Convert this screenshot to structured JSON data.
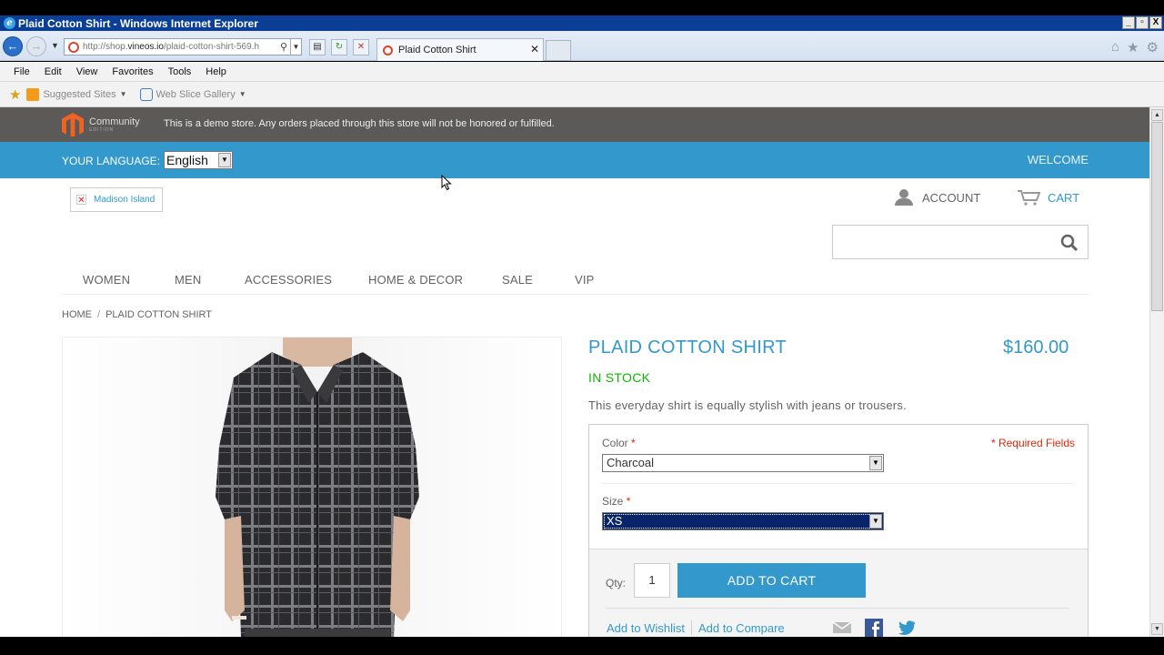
{
  "window": {
    "title": "Plaid Cotton Shirt - Windows Internet Explorer",
    "controls": [
      "_",
      "▫",
      "X"
    ]
  },
  "nav": {
    "url_prefix": "http://shop.",
    "url_host": "vineos.io",
    "url_path": "/plaid-cotton-shirt-569.h",
    "tab_title": "Plaid Cotton Shirt"
  },
  "menu": [
    "File",
    "Edit",
    "View",
    "Favorites",
    "Tools",
    "Help"
  ],
  "favorites": {
    "suggested": "Suggested Sites",
    "webslice": "Web Slice Gallery"
  },
  "store": {
    "logo_text": "Community",
    "logo_sub": "EDITION",
    "demo_notice": "This is a demo store. Any orders placed through this store will not be honored or fulfilled.",
    "language_label": "YOUR LANGUAGE:",
    "language_value": "English",
    "welcome": "WELCOME",
    "logo_alt": "Madison Island",
    "account": "ACCOUNT",
    "cart": "CART",
    "search_placeholder": "",
    "nav": [
      "WOMEN",
      "MEN",
      "ACCESSORIES",
      "HOME & DECOR",
      "SALE",
      "VIP"
    ],
    "breadcrumb": [
      "HOME",
      "PLAID COTTON SHIRT"
    ],
    "breadcrumb_sep": "/"
  },
  "product": {
    "name": "PLAID COTTON SHIRT",
    "price": "$160.00",
    "stock": "IN STOCK",
    "description": "This everyday shirt is equally stylish with jeans or trousers.",
    "required_note": "* Required Fields",
    "color_label": "Color",
    "color_value": "Charcoal",
    "size_label": "Size",
    "size_value": "XS",
    "asterisk": "*",
    "qty_label": "Qty:",
    "qty_value": "1",
    "add_to_cart": "ADD TO CART",
    "add_to_wishlist": "Add to Wishlist",
    "add_to_compare": "Add to Compare"
  },
  "colors": {
    "accent": "#3399cc",
    "demo_bar": "#5b5a58",
    "in_stock": "#11b400",
    "required": "#df280a"
  },
  "icons": [
    "ie-icon",
    "back-icon",
    "forward-icon",
    "search-icon",
    "home-icon",
    "star-icon",
    "gear-icon",
    "account-icon",
    "cart-icon",
    "email-icon",
    "facebook-icon",
    "twitter-icon",
    "magento-logo-icon"
  ]
}
